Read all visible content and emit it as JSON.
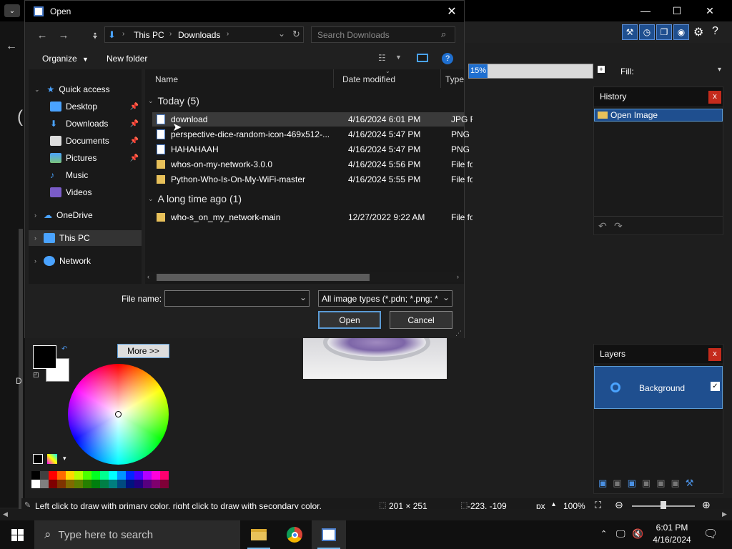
{
  "dialog": {
    "title": "Open",
    "address": {
      "root": "This PC",
      "folder": "Downloads"
    },
    "search_placeholder": "Search Downloads",
    "organize_label": "Organize",
    "new_folder_label": "New folder",
    "nav": {
      "quick_access": "Quick access",
      "desktop": "Desktop",
      "downloads": "Downloads",
      "documents": "Documents",
      "pictures": "Pictures",
      "music": "Music",
      "videos": "Videos",
      "onedrive": "OneDrive",
      "this_pc": "This PC",
      "network": "Network"
    },
    "columns": {
      "name": "Name",
      "date": "Date modified",
      "type": "Type"
    },
    "groups": {
      "today": "Today (5)",
      "long_ago": "A long time ago (1)"
    },
    "files_today": [
      {
        "name": "download",
        "date": "4/16/2024 6:01 PM",
        "type": "JPG F",
        "kind": "doc"
      },
      {
        "name": "perspective-dice-random-icon-469x512-...",
        "date": "4/16/2024 5:47 PM",
        "type": "PNG",
        "kind": "doc"
      },
      {
        "name": "HAHAHAAH",
        "date": "4/16/2024 5:47 PM",
        "type": "PNG",
        "kind": "doc"
      },
      {
        "name": "whos-on-my-network-3.0.0",
        "date": "4/16/2024 5:56 PM",
        "type": "File fo",
        "kind": "folder"
      },
      {
        "name": "Python-Who-Is-On-My-WiFi-master",
        "date": "4/16/2024 5:55 PM",
        "type": "File fo",
        "kind": "folder"
      }
    ],
    "files_old": [
      {
        "name": "who-s_on_my_network-main",
        "date": "12/27/2022 9:22 AM",
        "type": "File fo",
        "kind": "folder"
      }
    ],
    "file_name_label": "File name:",
    "file_name_value": "",
    "file_type_value": "All image types (*.pdn; *.png; *",
    "open_label": "Open",
    "cancel_label": "Cancel"
  },
  "app": {
    "zoom_percent": "15%",
    "fill_label": "Fill:",
    "history_title": "History",
    "history_item": "Open Image",
    "layers_title": "Layers",
    "layer_name": "Background",
    "more_label": "More >>",
    "status_hint": "Left click to draw with primary color, right click to draw with secondary color.",
    "status_size": "201 × 251",
    "status_coords": "-223, -109",
    "status_unit": "px",
    "status_zoom": "100%"
  },
  "taskbar": {
    "search_placeholder": "Type here to search",
    "time": "6:01 PM",
    "date": "4/16/2024"
  },
  "colors": {
    "accent": "#1f6fcf",
    "selection": "#1f4f8f"
  }
}
